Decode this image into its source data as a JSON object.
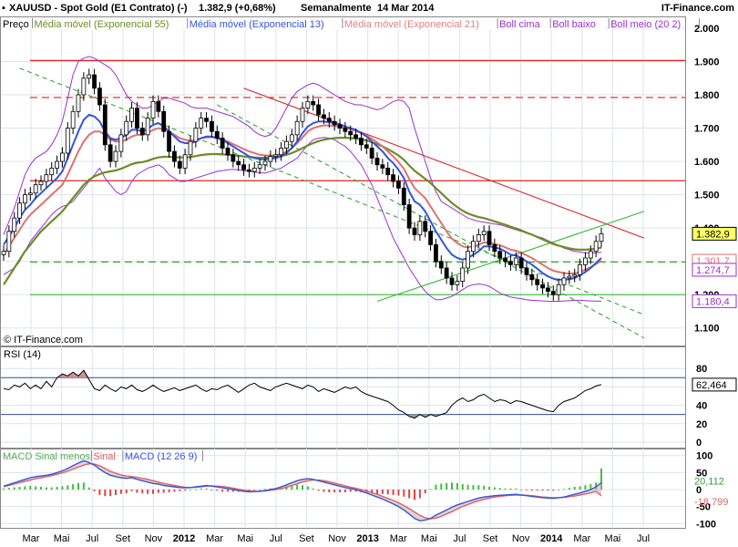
{
  "header": {
    "symbol": "XAUUSD - Spot Gold (E1 Contrato) (-)",
    "last": "1.382,9 (+0,68%)",
    "period": "Semanalmente",
    "date": "14 Mar 2014",
    "site": "IT-Finance.com"
  },
  "legend_main": [
    {
      "label": "Preço",
      "color": "#000000"
    },
    {
      "label": "Média móvel (Exponencial 55)",
      "color": "#6b8e23"
    },
    {
      "label": "Média móvel (Exponencial 13)",
      "color": "#3355dd"
    },
    {
      "label": "Média móvel (Exponencial 21)",
      "color": "#e08080"
    },
    {
      "label": "Boll cima",
      "color": "#9b30d0"
    },
    {
      "label": "Boll baixo",
      "color": "#9b30d0"
    },
    {
      "label": "Boll meio (20 2)",
      "color": "#9b30d0"
    }
  ],
  "copyright": "© IT-Finance.com",
  "rsi_label": "RSI (14)",
  "macd_legend": [
    {
      "label": "MACD Sinal menos",
      "color": "#5aaa5a"
    },
    {
      "label": "Sinal",
      "color": "#e06060"
    },
    {
      "label": "MACD (12 26 9)",
      "color": "#3355dd"
    }
  ],
  "colors": {
    "price": "#000000",
    "ema55": "#6b8e23",
    "ema13": "#3355dd",
    "ema21": "#e07070",
    "boll": "#9b30d0",
    "resistance": "#dd2222",
    "trend_up": "#33bb33",
    "trend_dash": "#33aa33",
    "rsi": "#000000",
    "rsi_fill": "#c89090",
    "rsi_fill_low": "#80b080",
    "macd": "#3355dd",
    "signal": "#e06060",
    "hist_pos": "#44bb44",
    "hist_neg": "#dd4444"
  },
  "chart_data": [
    {
      "type": "candlestick",
      "title": "XAUUSD - Spot Gold (E1 Contrato) (-)",
      "y_ticks": [
        "2.000",
        "1.900",
        "1.800",
        "1.700",
        "1.600",
        "1.500",
        "1.400",
        "1.300",
        "1.200",
        "1.100"
      ],
      "ylim": [
        1050,
        2030
      ],
      "x_ticks": [
        "Mar",
        "Mai",
        "Jul",
        "Set",
        "Nov",
        "2012",
        "Mar",
        "Mai",
        "Jul",
        "Set",
        "Nov",
        "2013",
        "Mar",
        "Mai",
        "Jul",
        "Set",
        "Nov",
        "2014",
        "Mar",
        "Mai",
        "Jul"
      ],
      "value_labels": [
        {
          "text": "1.382,9",
          "value": 1382.9,
          "color": "#000000",
          "bg": "#ffff66"
        },
        {
          "text": "1.301,7",
          "value": 1301.7,
          "color": "#e07070",
          "bg": "#ffffff"
        },
        {
          "text": "1.274,7",
          "value": 1274.7,
          "color": "#9b30d0",
          "bg": "#ffffff"
        },
        {
          "text": "1.180,4",
          "value": 1180.4,
          "color": "#9b30d0",
          "bg": "#ffffff"
        }
      ],
      "horizontal_levels": [
        {
          "value": 1903,
          "style": "solid",
          "color": "#dd2222"
        },
        {
          "value": 1792,
          "style": "dashed",
          "color": "#dd2222"
        },
        {
          "value": 1542,
          "style": "solid",
          "color": "#dd2222"
        },
        {
          "value": 1298,
          "style": "dashed",
          "color": "#33aa33"
        },
        {
          "value": 1200,
          "style": "solid",
          "color": "#33bb33"
        }
      ],
      "closes": [
        1330,
        1390,
        1430,
        1475,
        1500,
        1505,
        1530,
        1540,
        1560,
        1580,
        1600,
        1625,
        1700,
        1750,
        1800,
        1850,
        1860,
        1820,
        1770,
        1650,
        1600,
        1630,
        1680,
        1720,
        1760,
        1700,
        1680,
        1730,
        1780,
        1750,
        1690,
        1630,
        1600,
        1580,
        1620,
        1660,
        1700,
        1730,
        1720,
        1690,
        1670,
        1640,
        1620,
        1600,
        1590,
        1575,
        1570,
        1580,
        1590,
        1600,
        1615,
        1620,
        1640,
        1660,
        1680,
        1720,
        1760,
        1780,
        1770,
        1740,
        1730,
        1720,
        1710,
        1700,
        1690,
        1680,
        1670,
        1650,
        1640,
        1610,
        1590,
        1580,
        1560,
        1540,
        1520,
        1470,
        1400,
        1380,
        1420,
        1390,
        1350,
        1300,
        1280,
        1250,
        1230,
        1240,
        1280,
        1330,
        1360,
        1380,
        1390,
        1350,
        1330,
        1310,
        1300,
        1290,
        1310,
        1280,
        1260,
        1245,
        1230,
        1220,
        1210,
        1200,
        1230,
        1250,
        1255,
        1260,
        1290,
        1310,
        1330,
        1360,
        1382.9
      ],
      "ema13": [
        1350,
        1375,
        1400,
        1430,
        1455,
        1470,
        1490,
        1505,
        1520,
        1535,
        1550,
        1570,
        1610,
        1650,
        1690,
        1725,
        1740,
        1735,
        1720,
        1690,
        1670,
        1665,
        1670,
        1680,
        1695,
        1695,
        1690,
        1698,
        1710,
        1715,
        1705,
        1690,
        1675,
        1660,
        1655,
        1655,
        1660,
        1670,
        1675,
        1675,
        1670,
        1665,
        1655,
        1645,
        1635,
        1625,
        1615,
        1610,
        1607,
        1606,
        1608,
        1610,
        1615,
        1625,
        1640,
        1660,
        1685,
        1705,
        1715,
        1720,
        1720,
        1718,
        1715,
        1712,
        1705,
        1700,
        1695,
        1685,
        1675,
        1660,
        1645,
        1630,
        1610,
        1595,
        1575,
        1550,
        1510,
        1480,
        1470,
        1450,
        1420,
        1390,
        1365,
        1340,
        1320,
        1310,
        1305,
        1310,
        1320,
        1330,
        1345,
        1345,
        1342,
        1338,
        1330,
        1320,
        1318,
        1310,
        1300,
        1290,
        1278,
        1265,
        1255,
        1248,
        1245,
        1245,
        1246,
        1250,
        1258,
        1268,
        1280,
        1295,
        1310
      ],
      "ema21": [
        1320,
        1345,
        1370,
        1395,
        1420,
        1440,
        1455,
        1470,
        1485,
        1500,
        1515,
        1530,
        1560,
        1595,
        1630,
        1660,
        1680,
        1690,
        1690,
        1680,
        1665,
        1660,
        1660,
        1665,
        1675,
        1680,
        1680,
        1685,
        1695,
        1700,
        1698,
        1690,
        1680,
        1670,
        1665,
        1662,
        1665,
        1670,
        1672,
        1673,
        1670,
        1667,
        1660,
        1652,
        1645,
        1637,
        1630,
        1625,
        1620,
        1618,
        1618,
        1618,
        1622,
        1630,
        1640,
        1655,
        1672,
        1690,
        1700,
        1705,
        1708,
        1708,
        1707,
        1705,
        1700,
        1697,
        1692,
        1685,
        1678,
        1668,
        1657,
        1645,
        1630,
        1615,
        1598,
        1578,
        1548,
        1520,
        1505,
        1490,
        1465,
        1440,
        1415,
        1390,
        1368,
        1355,
        1345,
        1342,
        1345,
        1350,
        1357,
        1356,
        1352,
        1348,
        1342,
        1335,
        1332,
        1326,
        1318,
        1310,
        1300,
        1290,
        1280,
        1272,
        1268,
        1265,
        1263,
        1264,
        1268,
        1275,
        1283,
        1292,
        1301.7
      ],
      "ema55": [
        1230,
        1255,
        1280,
        1305,
        1330,
        1350,
        1370,
        1390,
        1405,
        1420,
        1435,
        1450,
        1470,
        1490,
        1510,
        1530,
        1545,
        1555,
        1562,
        1567,
        1570,
        1573,
        1578,
        1585,
        1592,
        1596,
        1598,
        1602,
        1608,
        1612,
        1614,
        1614,
        1613,
        1612,
        1612,
        1613,
        1616,
        1619,
        1621,
        1622,
        1622,
        1621,
        1620,
        1619,
        1617,
        1615,
        1613,
        1612,
        1611,
        1611,
        1612,
        1613,
        1616,
        1620,
        1625,
        1632,
        1640,
        1648,
        1655,
        1661,
        1665,
        1668,
        1670,
        1671,
        1671,
        1670,
        1669,
        1666,
        1663,
        1658,
        1652,
        1645,
        1637,
        1628,
        1618,
        1605,
        1588,
        1572,
        1560,
        1548,
        1535,
        1520,
        1505,
        1490,
        1475,
        1463,
        1452,
        1444,
        1438,
        1433,
        1430,
        1425,
        1420,
        1415,
        1410,
        1404,
        1399,
        1393,
        1386,
        1380,
        1373,
        1366,
        1359,
        1352,
        1347,
        1343,
        1339,
        1336,
        1335,
        1335,
        1336,
        1338,
        1341
      ],
      "boll_up": [
        1380,
        1420,
        1460,
        1510,
        1560,
        1590,
        1610,
        1620,
        1630,
        1650,
        1680,
        1720,
        1790,
        1860,
        1900,
        1910,
        1915,
        1910,
        1900,
        1890,
        1880,
        1860,
        1830,
        1800,
        1780,
        1770,
        1760,
        1760,
        1770,
        1780,
        1790,
        1790,
        1785,
        1780,
        1775,
        1765,
        1760,
        1760,
        1760,
        1755,
        1750,
        1745,
        1740,
        1735,
        1725,
        1715,
        1705,
        1690,
        1680,
        1675,
        1680,
        1700,
        1730,
        1760,
        1790,
        1810,
        1820,
        1830,
        1835,
        1830,
        1820,
        1810,
        1800,
        1790,
        1780,
        1775,
        1770,
        1770,
        1765,
        1760,
        1755,
        1760,
        1770,
        1780,
        1785,
        1780,
        1760,
        1700,
        1650,
        1600,
        1550,
        1510,
        1480,
        1470,
        1460,
        1450,
        1440,
        1430,
        1425,
        1420,
        1418,
        1415,
        1412,
        1410,
        1405,
        1400,
        1395,
        1390,
        1385,
        1380,
        1375,
        1370,
        1362,
        1355,
        1348,
        1340,
        1335,
        1330,
        1328,
        1325,
        1325,
        1326,
        1327
      ],
      "boll_low": [
        1260,
        1270,
        1280,
        1300,
        1330,
        1360,
        1380,
        1400,
        1420,
        1440,
        1455,
        1465,
        1470,
        1480,
        1500,
        1520,
        1540,
        1560,
        1580,
        1550,
        1530,
        1510,
        1500,
        1510,
        1540,
        1560,
        1570,
        1580,
        1585,
        1590,
        1580,
        1560,
        1550,
        1540,
        1540,
        1545,
        1550,
        1555,
        1560,
        1565,
        1570,
        1572,
        1575,
        1576,
        1575,
        1572,
        1570,
        1568,
        1566,
        1565,
        1570,
        1575,
        1580,
        1590,
        1600,
        1610,
        1630,
        1650,
        1665,
        1670,
        1672,
        1670,
        1665,
        1655,
        1645,
        1630,
        1610,
        1590,
        1560,
        1530,
        1490,
        1450,
        1410,
        1370,
        1340,
        1310,
        1280,
        1255,
        1230,
        1210,
        1195,
        1185,
        1185,
        1190,
        1195,
        1205,
        1215,
        1225,
        1230,
        1232,
        1230,
        1225,
        1215,
        1205,
        1198,
        1193,
        1190,
        1188,
        1185,
        1183,
        1182,
        1181,
        1180.4,
        1180,
        1180,
        1181,
        1182,
        1183,
        1183,
        1182,
        1181,
        1180.5,
        1180.4
      ],
      "resistance_line": [
        {
          "x_index": 45,
          "y": 1820
        },
        {
          "x_index": 120,
          "y": 1370
        }
      ],
      "support_uptrend": [
        {
          "x_index": 70,
          "y": 1180
        },
        {
          "x_index": 120,
          "y": 1450
        }
      ],
      "channel_top": [
        {
          "x_index": 3,
          "y": 1880
        },
        {
          "x_index": 120,
          "y": 1140
        }
      ],
      "channel_bottom": [
        {
          "x_index": 40,
          "y": 1770
        },
        {
          "x_index": 120,
          "y": 1070
        }
      ]
    },
    {
      "type": "line",
      "title": "RSI (14)",
      "ylim": [
        -5,
        100
      ],
      "y_ticks": [
        "80",
        "60",
        "40",
        "20",
        "0"
      ],
      "levels": [
        70,
        30
      ],
      "current_label": "62,464",
      "values": [
        58,
        57,
        62,
        60,
        64,
        58,
        62,
        58,
        66,
        60,
        70,
        74,
        72,
        76,
        72,
        78,
        68,
        58,
        56,
        62,
        58,
        55,
        60,
        58,
        62,
        57,
        55,
        58,
        62,
        58,
        55,
        57,
        59,
        56,
        58,
        60,
        62,
        58,
        55,
        58,
        57,
        60,
        62,
        58,
        54,
        58,
        62,
        64,
        60,
        58,
        56,
        60,
        62,
        64,
        62,
        60,
        58,
        62,
        60,
        55,
        58,
        56,
        54,
        57,
        60,
        58,
        60,
        55,
        52,
        50,
        48,
        46,
        44,
        40,
        35,
        32,
        28,
        26,
        30,
        27,
        30,
        28,
        30,
        32,
        40,
        45,
        48,
        44,
        46,
        50,
        52,
        48,
        44,
        46,
        45,
        42,
        45,
        44,
        42,
        40,
        38,
        36,
        34,
        33,
        40,
        44,
        46,
        48,
        52,
        56,
        58,
        61,
        62.464
      ]
    },
    {
      "type": "bar+line",
      "title": "MACD (12 26 9)",
      "ylim": [
        -110,
        110
      ],
      "y_ticks": [
        "100",
        "50",
        "0",
        "-50",
        "-100"
      ],
      "current_labels": [
        {
          "text": "20,112",
          "color": "#3a9a3a"
        },
        {
          "text": "-18,799",
          "color": "#e06060"
        }
      ],
      "macd": [
        10,
        15,
        20,
        25,
        30,
        35,
        38,
        40,
        42,
        45,
        50,
        55,
        62,
        70,
        78,
        85,
        80,
        72,
        60,
        50,
        42,
        38,
        35,
        33,
        35,
        30,
        26,
        22,
        18,
        16,
        12,
        10,
        8,
        6,
        5,
        6,
        8,
        10,
        12,
        10,
        8,
        5,
        3,
        0,
        -3,
        -5,
        -7,
        -6,
        -5,
        -3,
        0,
        3,
        8,
        14,
        20,
        26,
        30,
        32,
        30,
        26,
        22,
        18,
        14,
        10,
        6,
        3,
        0,
        -5,
        -10,
        -16,
        -22,
        -28,
        -35,
        -42,
        -50,
        -60,
        -72,
        -85,
        -92,
        -90,
        -85,
        -75,
        -68,
        -60,
        -52,
        -45,
        -40,
        -35,
        -30,
        -25,
        -22,
        -20,
        -18,
        -17,
        -16,
        -15,
        -14,
        -16,
        -18,
        -20,
        -22,
        -24,
        -25,
        -26,
        -24,
        -22,
        -18,
        -14,
        -10,
        -5,
        0,
        8,
        20.112
      ],
      "signal": [
        8,
        12,
        16,
        20,
        24,
        28,
        32,
        35,
        38,
        41,
        45,
        49,
        54,
        60,
        66,
        72,
        76,
        75,
        70,
        62,
        54,
        48,
        43,
        40,
        38,
        36,
        33,
        30,
        26,
        22,
        18,
        15,
        12,
        9,
        7,
        6,
        7,
        8,
        10,
        11,
        10,
        9,
        7,
        4,
        1,
        -2,
        -4,
        -5,
        -5,
        -4,
        -2,
        0,
        3,
        7,
        12,
        17,
        22,
        26,
        28,
        28,
        26,
        23,
        19,
        15,
        11,
        7,
        4,
        0,
        -4,
        -9,
        -14,
        -20,
        -26,
        -32,
        -39,
        -47,
        -56,
        -66,
        -76,
        -83,
        -86,
        -84,
        -79,
        -72,
        -65,
        -57,
        -50,
        -44,
        -38,
        -33,
        -29,
        -25,
        -22,
        -20,
        -18,
        -17,
        -16,
        -16,
        -17,
        -18,
        -20,
        -22,
        -23,
        -24,
        -24,
        -23,
        -21,
        -19,
        -16,
        -13,
        -10,
        -5,
        -18.799
      ]
    }
  ]
}
